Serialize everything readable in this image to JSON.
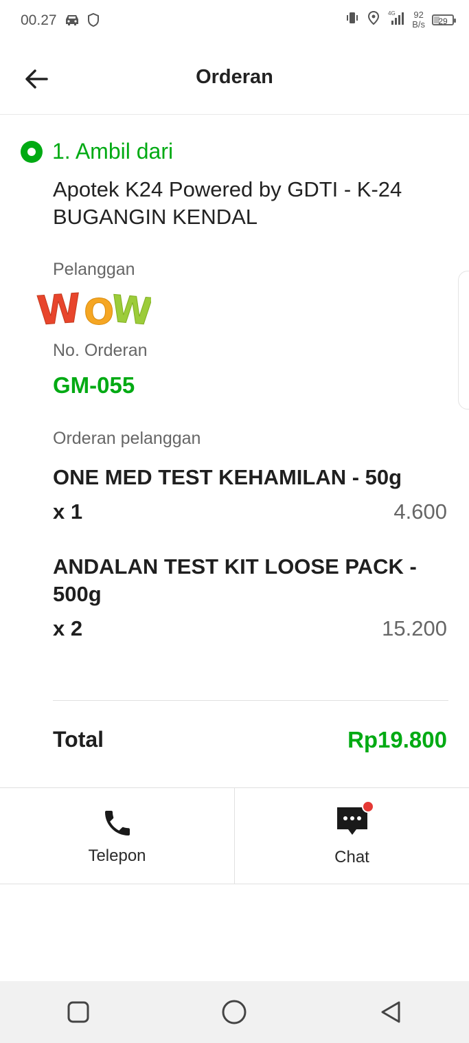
{
  "status_bar": {
    "time": "00.27",
    "network_type": "4G",
    "speed_value": "92",
    "speed_unit": "B/s",
    "battery": "29",
    "battery_level": 0.29
  },
  "header": {
    "title": "Orderan"
  },
  "pickup": {
    "label": "1. Ambil dari",
    "store_name": "Apotek K24 Powered by GDTI - K-24 BUGANGIN KENDAL"
  },
  "customer": {
    "label": "Pelanggan",
    "name_logo_text": "WOW"
  },
  "order": {
    "number_label": "No. Orderan",
    "number": "GM-055",
    "items_label": "Orderan pelanggan",
    "items": [
      {
        "name": "ONE MED TEST KEHAMILAN - 50g",
        "qty": "x 1",
        "price": "4.600"
      },
      {
        "name": "ANDALAN TEST KIT LOOSE PACK - 500g",
        "qty": "x 2",
        "price": "15.200"
      }
    ],
    "total_label": "Total",
    "total_value": "Rp19.800"
  },
  "actions": {
    "phone_label": "Telepon",
    "chat_label": "Chat"
  },
  "colors": {
    "accent": "#00AA13",
    "badge": "#e53935"
  },
  "icons": {
    "back": "arrow-left-icon",
    "phone": "phone-icon",
    "chat": "chat-bubble-icon",
    "nav_recent": "square-icon",
    "nav_home": "circle-icon",
    "nav_back": "triangle-back-icon"
  }
}
